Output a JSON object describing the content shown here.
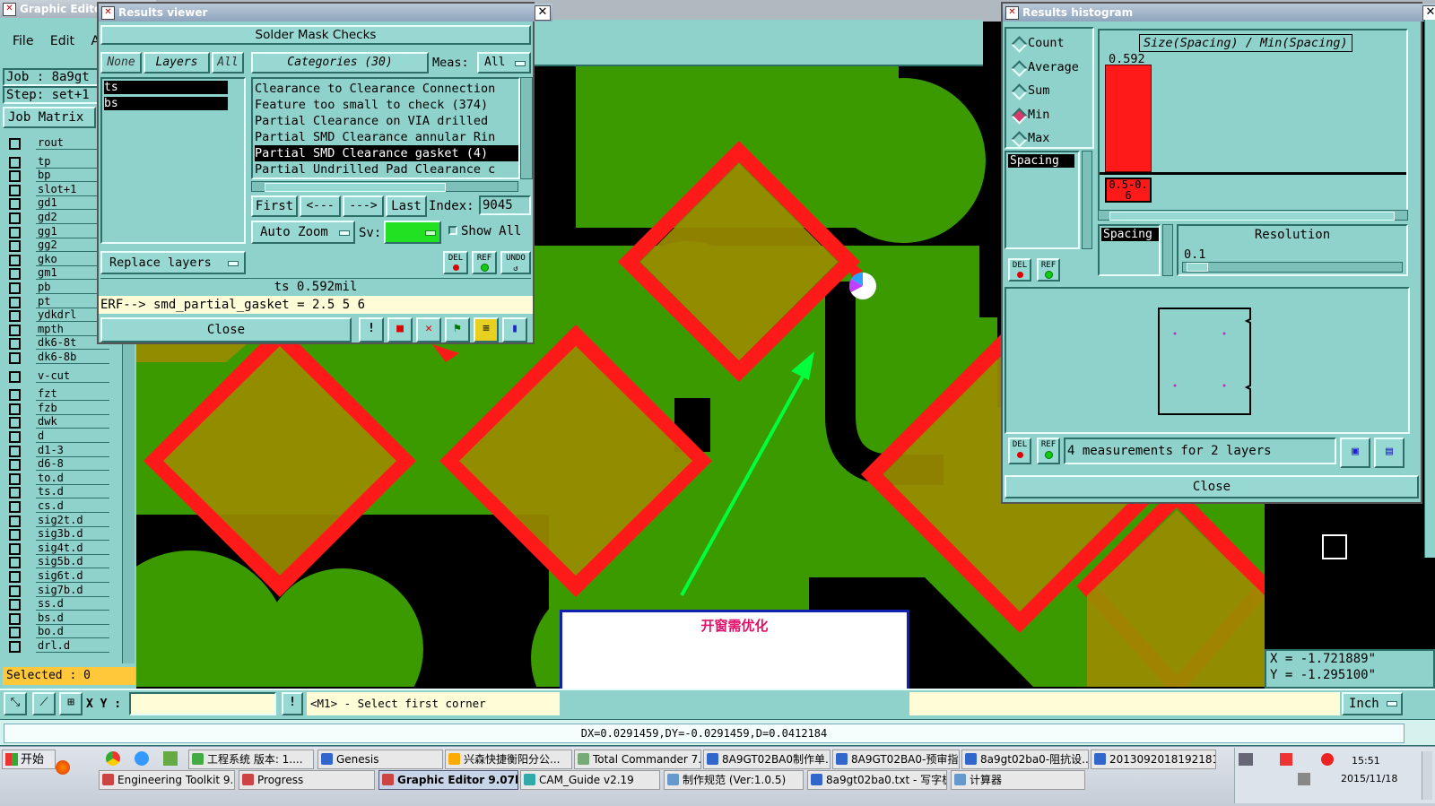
{
  "main_window": {
    "title": "Graphic Editor",
    "menu": [
      "File",
      "Edit",
      "A"
    ],
    "job_label": "Job : 8a9gt",
    "step_label": "Step: set+1",
    "job_matrix_button": "Job Matrix",
    "layers": [
      "rout",
      "tp",
      "bp",
      "slot+1",
      "gd1",
      "gd2",
      "gg1",
      "gg2",
      "gko",
      "gm1",
      "pb",
      "pt",
      "ydkdrl",
      "mpth",
      "dk6-8t",
      "dk6-8b",
      "v-cut",
      "fzt",
      "fzb",
      "dwk",
      "d",
      "d1-3",
      "d6-8",
      "to.d",
      "ts.d",
      "cs.d",
      "sig2t.d",
      "sig3b.d",
      "sig4t.d",
      "sig5b.d",
      "sig6t.d",
      "sig7b.d",
      "ss.d",
      "bs.d",
      "bo.d",
      "drl.d"
    ],
    "selected_label": "Selected : 0",
    "xy_label": "X Y :",
    "prompt": "<M1> - Select first corner",
    "units_button": "Inch",
    "delta_readout": "DX=0.0291459,DY=-0.0291459,D=0.0412184",
    "coord_x": "X = -1.721889\"",
    "coord_y": "Y = -1.295100\""
  },
  "results_viewer": {
    "title": "Results viewer",
    "heading": "Solder Mask Checks",
    "none_btn": "None",
    "layers_btn": "Layers",
    "all_btn": "All",
    "layer_list": [
      "ts",
      "bs"
    ],
    "categories_btn": "Categories (30)",
    "meas_label": "Meas:",
    "meas_value": "All",
    "categories": [
      "Clearance to Clearance Connection",
      "Feature too small to check (374)",
      "Partial Clearance on VIA drilled",
      "Partial SMD Clearance annular Rin",
      "Partial SMD Clearance gasket (4)",
      "Partial Undrilled Pad Clearance c"
    ],
    "selected_category_index": 4,
    "first_btn": "First",
    "prev_btn": "<---",
    "next_btn": "--->",
    "last_btn": "Last",
    "index_label": "Index:",
    "index_value": "9045",
    "auto_zoom": "Auto Zoom",
    "sv_label": "Sv:",
    "show_all": "Show All",
    "replace_layers": "Replace layers",
    "del_btn": "DEL",
    "ref_btn": "REF",
    "undo_btn": "UNDO",
    "measure_value": "ts 0.592mil",
    "erf_line": "ERF--> smd_partial_gasket = 2.5 5 6",
    "close_btn": "Close"
  },
  "results_histogram": {
    "title": "Results histogram",
    "options": [
      "Count",
      "Average",
      "Sum",
      "Min",
      "Max"
    ],
    "selected_option": "Min",
    "chart_title": "Size(Spacing) / Min(Spacing)",
    "bar_label": "0.592",
    "bar_range_label": "0.5-0.6",
    "spacing_item": "Spacing",
    "spacing_combo": "Spacing",
    "resolution_label": "Resolution",
    "resolution_value": "0.1",
    "del_btn": "DEL",
    "ref_btn": "REF",
    "measurements_text": "4 measurements for 2 layers",
    "close_btn": "Close"
  },
  "annotation": {
    "note_text": "开窗需优化",
    "note_color": "#e0106a",
    "arrow_color": "#00ff3c"
  },
  "taskbar": {
    "start_label": "开始",
    "row1": [
      "工程系统  版本: 1....",
      "Genesis",
      "兴森快捷衡阳分公...",
      "Total Commander 7.0...",
      "8A9GT02BA0制作单....",
      "8A9GT02BA0-预审指...",
      "8a9gt02ba0-阻抗设...",
      "20130920181921812..."
    ],
    "row2": [
      "Engineering Toolkit 9.07...",
      "Progress",
      "Graphic Editor 9.07b2 ...",
      "CAM_Guide v2.19",
      "制作规范 (Ver:1.0.5)",
      "8a9gt02ba0.txt - 写字板",
      "计算器"
    ],
    "clock_time": "15:51",
    "clock_date": "2015/11/18"
  },
  "colors": {
    "panel_teal": "#8fd1cb",
    "pad_green": "#3a9a00",
    "overlap_olive": "#9a8c00",
    "clearance_red": "#ff1a1a"
  }
}
